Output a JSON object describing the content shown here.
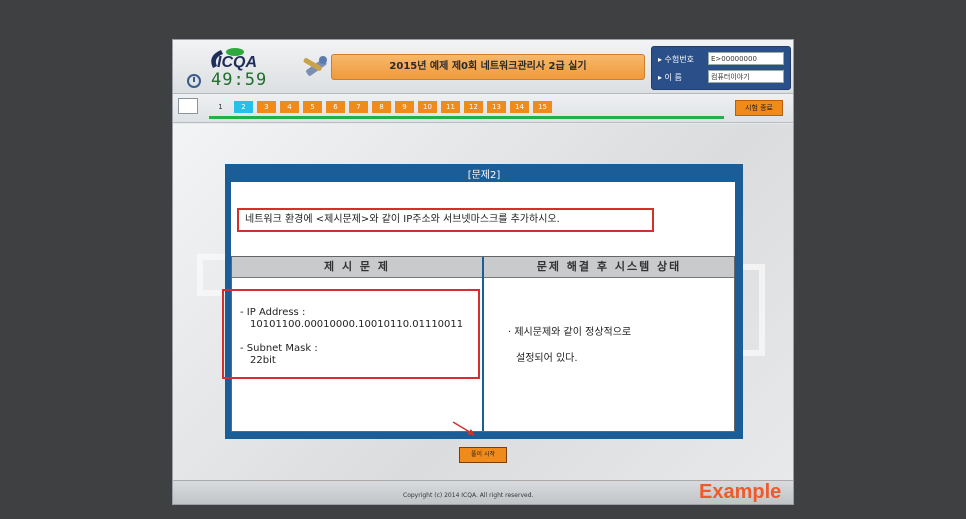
{
  "header": {
    "logo_text": "ICQA",
    "timer": "49:59",
    "exam_title": "2015년 예제 제0회 네트워크관리사 2급 실기",
    "exam_number_label": "▸ 수험번호",
    "exam_number_value": "E>00000000",
    "name_label": "▸ 이    름",
    "name_value": "컴퓨터이야기"
  },
  "nav": {
    "questions": [
      "1",
      "2",
      "3",
      "4",
      "5",
      "6",
      "7",
      "8",
      "9",
      "10",
      "11",
      "12",
      "13",
      "14",
      "15"
    ],
    "active_question": "2",
    "end_button": "시험 종료",
    "progress_fraction": 0.92
  },
  "question": {
    "title": "[문제2]",
    "instruction": "네트워크 환경에 <제시문제>와 같이 IP주소와 서브넷마스크를 추가하시오.",
    "left_header": "제 시 문 제",
    "right_header": "문제 해결 후 시스템 상태",
    "ip_label": "- IP Address :",
    "ip_value": "10101100.00010000.10010110.01110011",
    "mask_label": "- Subnet Mask :",
    "mask_value": "22bit",
    "result_line1": "· 제시문제와 같이 정상적으로",
    "result_line2": "설정되어 있다."
  },
  "start_button": "풀이 시작",
  "footer": {
    "copyright": "Copyright (c) 2014 ICQA. All right reserved.",
    "watermark": "Example"
  },
  "colors": {
    "accent_orange": "#f08a1a",
    "panel_blue": "#1b5d97",
    "highlight_red": "#d32f2f",
    "active_cyan": "#27c0e8"
  }
}
